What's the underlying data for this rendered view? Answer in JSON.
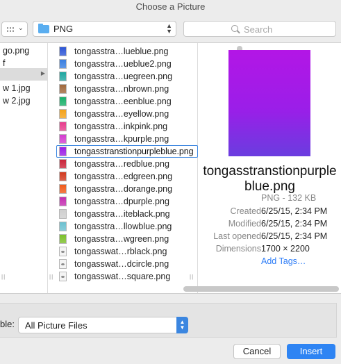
{
  "window": {
    "title": "Choose a Picture"
  },
  "toolbar": {
    "view_icon": "icon-grid-view",
    "path_folder": "PNG",
    "search_placeholder": "Search"
  },
  "sidebar_column": {
    "items": [
      "go.png",
      "f",
      "",
      "w 1.jpg",
      "w 2.jpg"
    ],
    "selected_index": 2
  },
  "files": [
    {
      "name": "tongasstra…lueblue.png",
      "color": "#2d56d6"
    },
    {
      "name": "tongasstra…ueblue2.png",
      "color": "#3a7fe0"
    },
    {
      "name": "tongasstra…uegreen.png",
      "color": "#1fa6a0"
    },
    {
      "name": "tongasstra…nbrown.png",
      "color": "#a0683c"
    },
    {
      "name": "tongasstra…eenblue.png",
      "color": "#18b06a"
    },
    {
      "name": "tongasstra…eyellow.png",
      "color": "#f4a21a"
    },
    {
      "name": "tongasstra…inkpink.png",
      "color": "#e63d8c"
    },
    {
      "name": "tongasstra…kpurple.png",
      "color": "#d33ccf"
    },
    {
      "name": "tongasstranstionpurpleblue.png",
      "color": "#9a1ce6",
      "selected": true
    },
    {
      "name": "tongasstra…redblue.png",
      "color": "#c9253a"
    },
    {
      "name": "tongasstra…edgreen.png",
      "color": "#d13a1f"
    },
    {
      "name": "tongasstra…dorange.png",
      "color": "#f05a1a"
    },
    {
      "name": "tongasstra…dpurple.png",
      "color": "#c32eb0"
    },
    {
      "name": "tongasstra…iteblack.png",
      "color": "#cfcfcf"
    },
    {
      "name": "tongasstra…llowblue.png",
      "color": "#6cc0d0"
    },
    {
      "name": "tongasstra…wgreen.png",
      "color": "#7bbf2a"
    },
    {
      "name": "tongasswat…rblack.png",
      "color": "#f2f2f2",
      "doc": true
    },
    {
      "name": "tongasswat…dcircle.png",
      "color": "#f2f2f2",
      "doc": true
    },
    {
      "name": "tongasswat…square.png",
      "color": "#f2f2f2",
      "doc": true
    }
  ],
  "preview": {
    "filename": "tongasstranstionpurpleblue.png",
    "kind": "PNG - 132 KB",
    "fields": [
      {
        "label": "Created",
        "value": "6/25/15, 2:34 PM"
      },
      {
        "label": "Modified",
        "value": "6/25/15, 2:34 PM"
      },
      {
        "label": "Last opened",
        "value": "6/25/15, 2:34 PM"
      },
      {
        "label": "Dimensions",
        "value": "1700 × 2200"
      }
    ],
    "add_tags": "Add Tags…"
  },
  "bottom": {
    "enable_label": "ble:",
    "file_type_value": "All Picture Files",
    "cancel_label": "Cancel",
    "insert_label": "Insert"
  }
}
